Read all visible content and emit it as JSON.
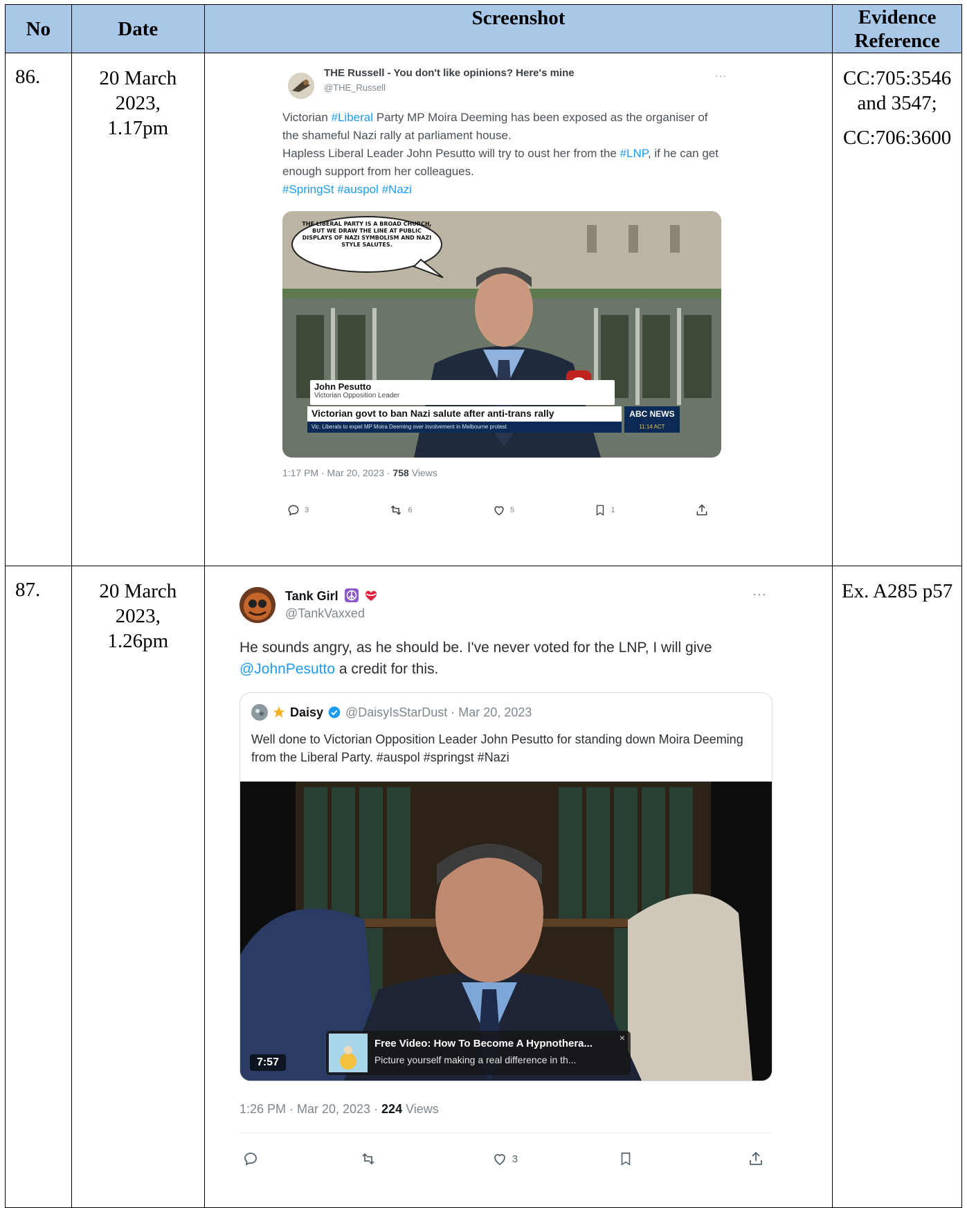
{
  "headers": {
    "no": "No",
    "date": "Date",
    "screenshot": "Screenshot",
    "evidence_line1": "Evidence",
    "evidence_line2": "Reference"
  },
  "rows": [
    {
      "no": "86.",
      "date_line1": "20 March",
      "date_line2": "2023,",
      "date_line3": "1.17pm",
      "ref_line1": "CC:705:3546",
      "ref_line2": "and 3547;",
      "ref_line3": "CC:706:3600",
      "tweet": {
        "name": "THE Russell - You don't like opinions? Here's mine",
        "handle": "@THE_Russell",
        "more": "···",
        "body_p1": "Victorian ",
        "tag_liberal": "#Liberal",
        "body_p2": " Party MP Moira Deeming has been exposed as the organiser of the shameful Nazi rally at parliament house.",
        "body_p3": "Hapless Liberal Leader John Pesutto will try to oust her from the ",
        "tag_lnp": "#LNP",
        "body_p4": ", if he can get enough support from her colleagues.",
        "hashtags": "#SpringSt #auspol #Nazi",
        "media": {
          "speech_bubble": "THE LIBERAL PARTY IS A BROAD CHURCH, BUT WE DRAW THE LINE AT PUBLIC DISPLAYS OF NAZI SYMBOLISM AND NAZI STYLE SALUTES.",
          "lower_third_name": "John Pesutto",
          "lower_third_title": "Victorian Opposition Leader",
          "headline": "Victorian govt to ban Nazi salute after anti-trans rally",
          "ticker": "Vic. Liberals to expel MP Moira Deeming over involvement in Melbourne protest",
          "network": "ABC NEWS",
          "clock": "11:14 ACT"
        },
        "stamp_prefix": "1:17 PM · Mar 20, 2023 · ",
        "views": "758",
        "views_label": " Views",
        "replies": "3",
        "retweets": "6",
        "likes": "5",
        "bookmarks": "1"
      }
    },
    {
      "no": "87.",
      "date_line1": "20 March",
      "date_line2": "2023,",
      "date_line3": "1.26pm",
      "ref_line1": "Ex. A285 p57",
      "tweet": {
        "name": "Tank Girl",
        "handle": "@TankVaxxed",
        "more": "···",
        "body_p1": "He sounds angry, as he should be. I've never voted for the LNP, I will give ",
        "mention": "@JohnPesutto",
        "body_p2": " a credit for this.",
        "quote": {
          "name": "Daisy",
          "handle_date": "@DaisyIsStarDust · Mar 20, 2023",
          "text": "Well done to Victorian Opposition Leader John Pesutto for standing down Moira Deeming from the Liberal Party. #auspol #springst #Nazi",
          "duration": "7:57",
          "ad_title": "Free Video: How To Become A Hypnothera...",
          "ad_sub": "Picture yourself making a real difference in th...",
          "ad_close": "×"
        },
        "stamp_prefix": "1:26 PM · Mar 20, 2023 · ",
        "views": "224",
        "views_label": " Views",
        "likes": "3"
      }
    }
  ],
  "colors": {
    "header_bg": "#a9c8e8",
    "link": "#1d9bf0",
    "muted": "#7d8790"
  }
}
